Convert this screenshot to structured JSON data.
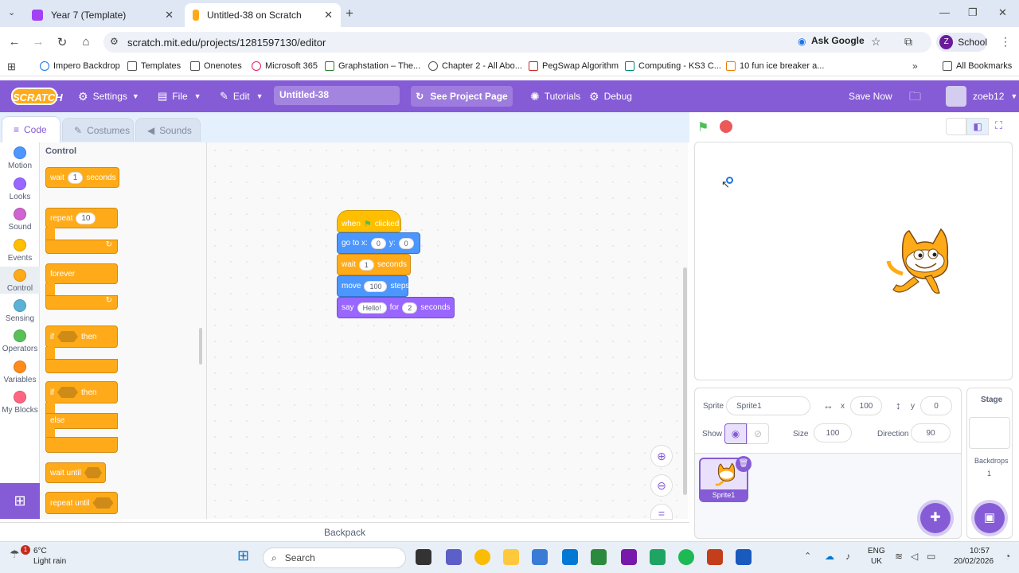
{
  "browser": {
    "tabs": [
      {
        "label": "Year 7 (Template)"
      },
      {
        "label": "Untitled-38 on Scratch"
      }
    ],
    "url": "scratch.mit.edu/projects/1281597130/editor",
    "ask_google": "Ask Google",
    "profile": "School",
    "bookmarks": [
      "Impero Backdrop",
      "Templates",
      "Onenotes",
      "Microsoft 365",
      "Graphstation – The...",
      "Chapter 2 - All Abo...",
      "PegSwap Algorithm",
      "Computing - KS3 C...",
      "10 fun ice breaker a..."
    ],
    "all_bookmarks": "All Bookmarks"
  },
  "menubar": {
    "logo": "SCRATCH",
    "settings": "Settings",
    "file": "File",
    "edit": "Edit",
    "project_title": "Untitled-38",
    "see_project": "See Project Page",
    "tutorials": "Tutorials",
    "debug": "Debug",
    "save_now": "Save Now",
    "username": "zoeb12"
  },
  "editor_tabs": {
    "code": "Code",
    "costumes": "Costumes",
    "sounds": "Sounds"
  },
  "categories": [
    {
      "label": "Motion",
      "color": "#4c97ff"
    },
    {
      "label": "Looks",
      "color": "#9966ff"
    },
    {
      "label": "Sound",
      "color": "#cf63cf"
    },
    {
      "label": "Events",
      "color": "#ffbf00"
    },
    {
      "label": "Control",
      "color": "#ffab19"
    },
    {
      "label": "Sensing",
      "color": "#5cb1d6"
    },
    {
      "label": "Operators",
      "color": "#59c059"
    },
    {
      "label": "Variables",
      "color": "#ff8c1a"
    },
    {
      "label": "My Blocks",
      "color": "#ff6680"
    }
  ],
  "palette": {
    "heading": "Control",
    "wait": {
      "a": "wait",
      "n": "1",
      "b": "seconds"
    },
    "repeat": {
      "a": "repeat",
      "n": "10"
    },
    "forever": "forever",
    "if_then": {
      "a": "if",
      "b": "then"
    },
    "if_else": {
      "a": "if",
      "b": "then",
      "c": "else"
    },
    "wait_until": "wait until",
    "repeat_until": "repeat until"
  },
  "script": {
    "hat": {
      "a": "when",
      "b": "clicked"
    },
    "goto": {
      "a": "go to x:",
      "x": "0",
      "b": "y:",
      "y": "0"
    },
    "wait": {
      "a": "wait",
      "n": "1",
      "b": "seconds"
    },
    "move": {
      "a": "move",
      "n": "100",
      "b": "steps"
    },
    "say": {
      "a": "say",
      "msg": "Hello!",
      "b": "for",
      "n": "2",
      "c": "seconds"
    }
  },
  "backpack": "Backpack",
  "sprite_info": {
    "sprite_label": "Sprite",
    "sprite_name": "Sprite1",
    "x_label": "x",
    "x": "100",
    "y_label": "y",
    "y": "0",
    "show_label": "Show",
    "size_label": "Size",
    "size": "100",
    "direction_label": "Direction",
    "direction": "90"
  },
  "sprite_thumb": "Sprite1",
  "stage_pane": {
    "title": "Stage",
    "backdrops_label": "Backdrops",
    "backdrops": "1"
  },
  "taskbar": {
    "temp": "6°C",
    "weather": "Light rain",
    "search": "Search",
    "lang1": "ENG",
    "lang2": "UK",
    "time": "10:57",
    "date": "20/02/2026",
    "notif": "1"
  }
}
